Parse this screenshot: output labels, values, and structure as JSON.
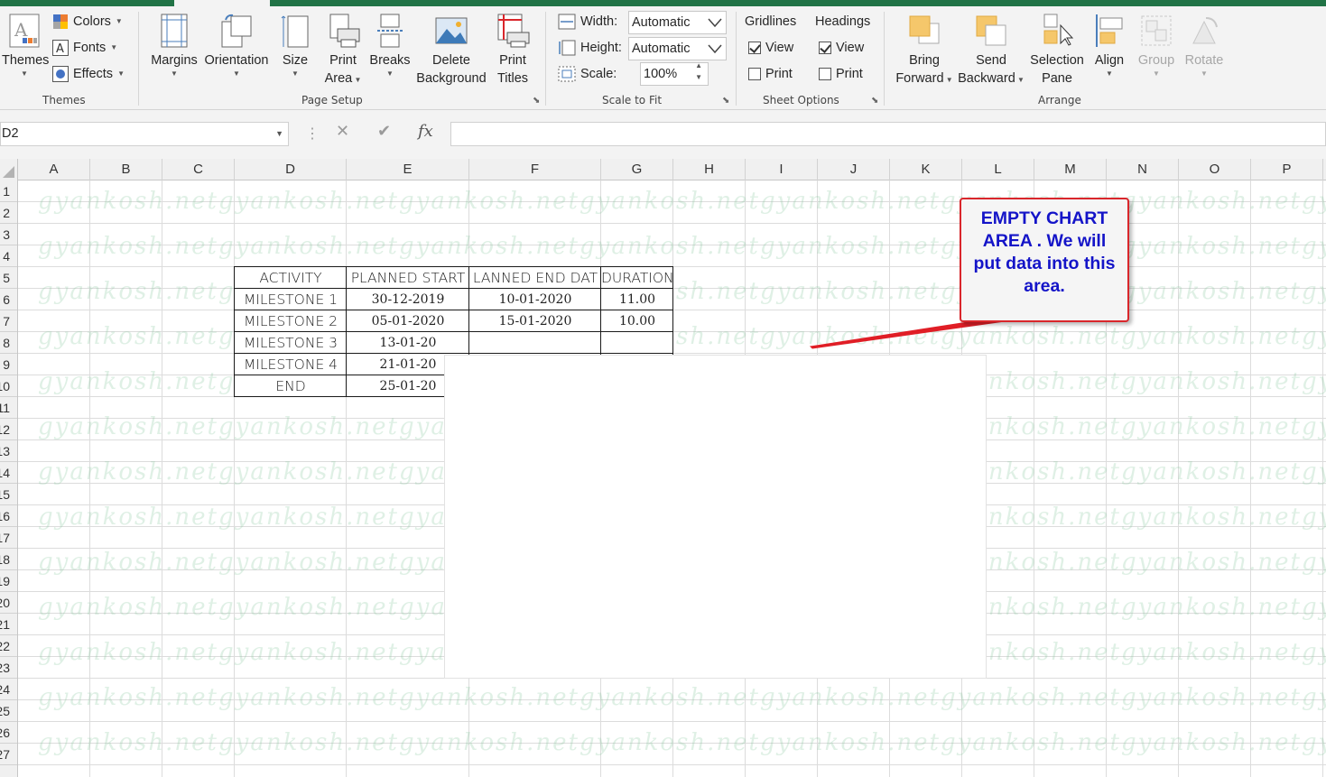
{
  "ribbon": {
    "themes_group": {
      "label": "Themes",
      "themes_button": "Themes",
      "colors": "Colors",
      "fonts": "Fonts",
      "effects": "Effects"
    },
    "page_setup_group": {
      "label": "Page Setup",
      "margins": "Margins",
      "orientation": "Orientation",
      "size": "Size",
      "print_area_l1": "Print",
      "print_area_l2": "Area",
      "breaks": "Breaks",
      "delete_bg_l1": "Delete",
      "delete_bg_l2": "Background",
      "print_titles_l1": "Print",
      "print_titles_l2": "Titles"
    },
    "scale_group": {
      "label": "Scale to Fit",
      "width_label": "Width:",
      "width_value": "Automatic",
      "height_label": "Height:",
      "height_value": "Automatic",
      "scale_label": "Scale:",
      "scale_value": "100%"
    },
    "sheet_options_group": {
      "label": "Sheet Options",
      "gridlines": "Gridlines",
      "headings": "Headings",
      "view": "View",
      "print": "Print"
    },
    "arrange_group": {
      "label": "Arrange",
      "bring_forward_l1": "Bring",
      "bring_forward_l2": "Forward",
      "send_backward_l1": "Send",
      "send_backward_l2": "Backward",
      "selection_pane_l1": "Selection",
      "selection_pane_l2": "Pane",
      "align": "Align",
      "group": "Group",
      "rotate": "Rotate"
    }
  },
  "formula_bar": {
    "name_box": "D2",
    "cancel_symbol": "✕",
    "enter_symbol": "✔",
    "fx_symbol": "fx",
    "formula": ""
  },
  "sheet": {
    "columns": [
      "A",
      "B",
      "C",
      "D",
      "E",
      "F",
      "G",
      "H",
      "I",
      "J",
      "K",
      "L",
      "M",
      "N",
      "O",
      "P"
    ],
    "rows": [
      "1",
      "2",
      "3",
      "4",
      "5",
      "6",
      "7",
      "8",
      "9",
      "10",
      "11",
      "12",
      "13",
      "14",
      "15",
      "16",
      "17",
      "18",
      "19",
      "20",
      "21",
      "22",
      "23",
      "24",
      "25",
      "26",
      "27"
    ],
    "watermark": "gyankosh.net",
    "table": {
      "headers": [
        "ACTIVITY",
        "PLANNED START",
        "LANNED END DAT",
        "DURATION"
      ],
      "rows": [
        [
          "MILESTONE 1",
          "30-12-2019",
          "10-01-2020",
          "11.00"
        ],
        [
          "MILESTONE 2",
          "05-01-2020",
          "15-01-2020",
          "10.00"
        ],
        [
          "MILESTONE 3",
          "13-01-20",
          "",
          ""
        ],
        [
          "MILESTONE 4",
          "21-01-20",
          "",
          ""
        ],
        [
          "END",
          "25-01-20",
          "",
          ""
        ]
      ]
    }
  },
  "callout": {
    "text": "EMPTY CHART AREA . We will put data into this area."
  },
  "colors": {
    "excel_green": "#217346",
    "callout_border": "#d9262b",
    "callout_text": "#1414c8"
  }
}
